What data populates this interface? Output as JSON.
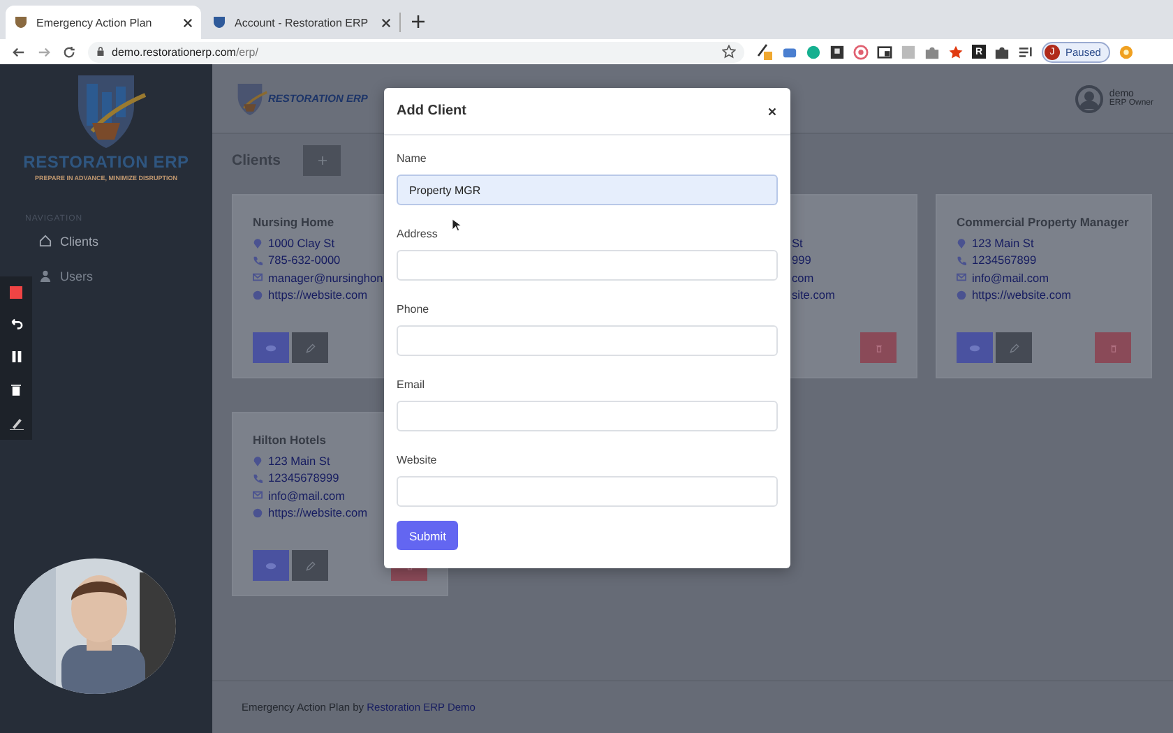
{
  "browser": {
    "tabs": [
      {
        "title": "Emergency Action Plan",
        "selected": true
      },
      {
        "title": "Account - Restoration ERP",
        "selected": false
      }
    ],
    "url_host": "demo.restorationerp.com",
    "url_path": "/erp/",
    "extension_letter": "R",
    "profile": {
      "initial": "J",
      "status": "Paused"
    }
  },
  "sidebar": {
    "logo_text": "RESTORATION ERP",
    "tagline": "PREPARE IN ADVANCE, MINIMIZE DISRUPTION",
    "section": "NAVIGATION",
    "items": [
      {
        "label": "Clients",
        "selected": true
      },
      {
        "label": "Users",
        "selected": false
      }
    ]
  },
  "header": {
    "logo_text": "RESTORATION ERP",
    "user": {
      "name": "demo",
      "role": "ERP Owner"
    }
  },
  "page_title": "Clients",
  "clients": [
    {
      "kind": "full",
      "name": "Nursing Home",
      "address": "1000 Clay St",
      "phone": "785-632-0000",
      "email": "manager@nursinghon",
      "website": "https://website.com",
      "buttons": [
        {
          "kind": "view"
        },
        {
          "kind": "edit"
        }
      ]
    },
    {
      "kind": "partial",
      "address": "St",
      "phone": "999",
      "email": "com",
      "website": "site.com",
      "buttons": [
        {
          "kind": "delete"
        }
      ]
    },
    {
      "kind": "full",
      "name": "Commercial Property Manager",
      "address": "123 Main St",
      "phone": "1234567899",
      "email": "info@mail.com",
      "website": "https://website.com",
      "buttons": [
        {
          "kind": "view"
        },
        {
          "kind": "edit"
        },
        {
          "kind": "delete"
        }
      ]
    },
    {
      "kind": "full",
      "name": "Hilton Hotels",
      "address": "123 Main St",
      "phone": "12345678999",
      "email": "info@mail.com",
      "website": "https://website.com",
      "buttons": [
        {
          "kind": "view"
        },
        {
          "kind": "edit"
        },
        {
          "kind": "delete"
        }
      ]
    }
  ],
  "modal": {
    "title": "Add Client",
    "fields": [
      {
        "label": "Name",
        "value": "Property MGR",
        "focused": true
      },
      {
        "label": "Address",
        "focused": false
      },
      {
        "label": "Phone",
        "focused": false
      },
      {
        "label": "Email",
        "focused": false
      },
      {
        "label": "Website",
        "focused": false
      }
    ],
    "submit": "Submit"
  },
  "footer": {
    "text": "Emergency Action Plan by",
    "link": "Restoration ERP Demo"
  }
}
